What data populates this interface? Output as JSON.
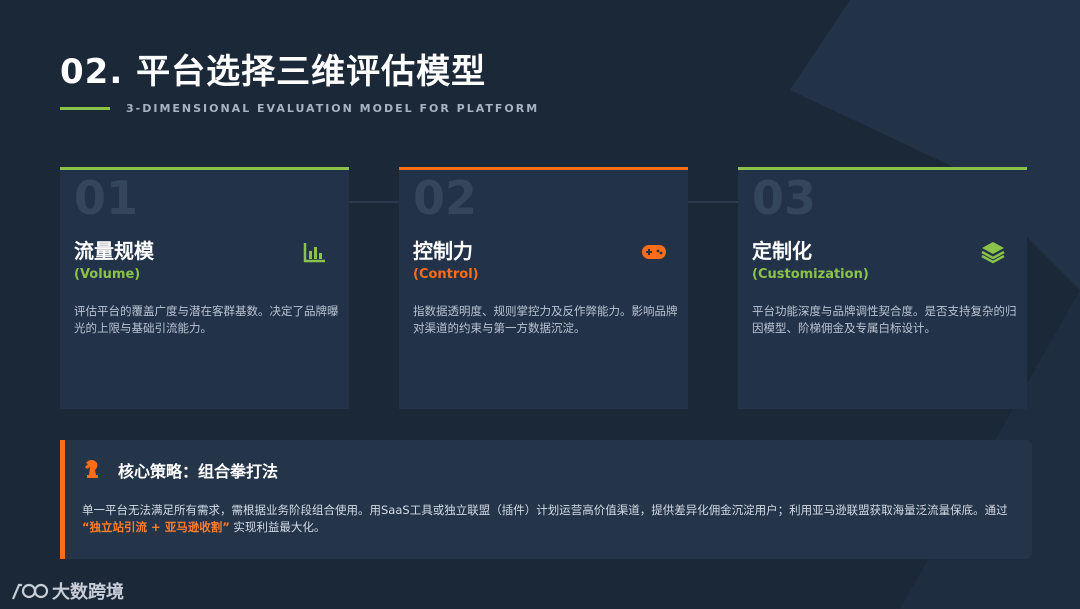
{
  "header": {
    "title": "02. 平台选择三维评估模型",
    "subtitle": "3-DIMENSIONAL EVALUATION MODEL FOR PLATFORM"
  },
  "cards": [
    {
      "number": "01",
      "title": "流量规模",
      "en": "(Volume)",
      "icon": "bar-chart-icon",
      "accent": "#8bc34a",
      "desc": "评估平台的覆盖广度与潜在客群基数。决定了品牌曝光的上限与基础引流能力。"
    },
    {
      "number": "02",
      "title": "控制力",
      "en": "(Control)",
      "icon": "gamepad-icon",
      "accent": "#ff6d1a",
      "desc": "指数据透明度、规则掌控力及反作弊能力。影响品牌对渠道的约束与第一方数据沉淀。"
    },
    {
      "number": "03",
      "title": "定制化",
      "en": "(Customization)",
      "icon": "layers-icon",
      "accent": "#8bc34a",
      "desc": "平台功能深度与品牌调性契合度。是否支持复杂的归因模型、阶梯佣金及专属白标设计。"
    }
  ],
  "strategy": {
    "icon": "chess-knight-icon",
    "title": "核心策略：组合拳打法",
    "text_before": "单一平台无法满足所有需求，需根据业务阶段组合使用。用SaaS工具或独立联盟（插件）计划运营高价值渠道，提供差异化佣金沉淀用户；利用亚马逊联盟获取海量泛流量保底。通过 ",
    "highlight": "“独立站引流 + 亚马逊收割”",
    "text_after": " 实现利益最大化。",
    "accent": "#ff6d1a"
  },
  "brand": {
    "logo_icon": "brand-logo-icon",
    "name": "大数跨境"
  },
  "colors": {
    "background": "#1b2838",
    "card": "#223248",
    "green": "#8bc34a",
    "orange": "#ff6d1a"
  }
}
